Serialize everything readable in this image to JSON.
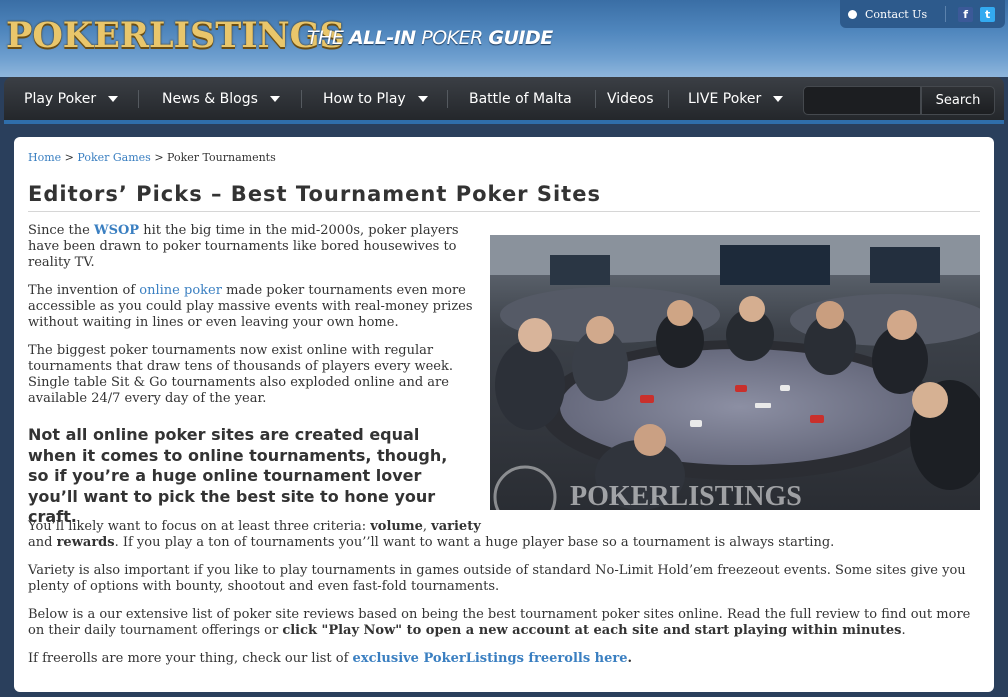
{
  "header": {
    "logo_text": "POKERLISTINGS",
    "tagline_prefix": "THE ",
    "tagline_bold": "ALL-IN",
    "tagline_mid": " POKER ",
    "tagline_end": "GUIDE",
    "contact_label": "Contact Us",
    "facebook_glyph": "f",
    "twitter_glyph": "t"
  },
  "nav": {
    "items": [
      {
        "label": "Play Poker",
        "has_dropdown": true
      },
      {
        "label": "News & Blogs",
        "has_dropdown": true
      },
      {
        "label": "How to Play",
        "has_dropdown": true
      },
      {
        "label": "Battle of Malta",
        "has_dropdown": false
      },
      {
        "label": "Videos",
        "has_dropdown": false
      },
      {
        "label": "LIVE Poker",
        "has_dropdown": true
      }
    ],
    "search_placeholder": "",
    "search_button": "Search"
  },
  "breadcrumb": {
    "home": "Home",
    "sep1": " > ",
    "games": "Poker Games",
    "sep2": " > ",
    "current": "Poker Tournaments"
  },
  "article": {
    "title": "Editors’ Picks – Best Tournament Poker Sites",
    "p1_a": "Since the ",
    "p1_link": "WSOP",
    "p1_b": " hit the big time in the mid-2000s, poker players have been drawn to poker tournaments like bored housewives to reality TV.",
    "p2_a": "The invention of ",
    "p2_link": "online poker",
    "p2_b": " made poker tournaments even more accessible as you could play massive events with real-money prizes without waiting in lines or even leaving your own home.",
    "p3": "The biggest poker tournaments now exist online with regular tournaments that draw tens of thousands of players every week. Single table Sit & Go tournaments also exploded online and are available 24/7 every day of the year.",
    "lead": "Not all online poker sites are created equal when it comes to online tournaments, though, so if you’re a huge online tournament lover you’ll want to pick the best site to hone your craft.",
    "p4_line1_a": "You’ll likely want to focus on at least three criteria: ",
    "p4_volume": "volume",
    "p4_comma": ", ",
    "p4_variety": "variety",
    "p4_and": "and ",
    "p4_rewards": "rewards",
    "p4_rest": ". If you play a ton of tournaments you’’ll want to want a huge player base so a tournament is always starting.",
    "p5": "Variety is also important if you like to play tournaments in games outside of standard No-Limit Hold’em freezeout events. Some sites give you plenty of options with bounty, shootout and even fast-fold tournaments.",
    "p6_a": "Below is a our extensive list of poker site reviews based on being the best tournament poker sites online. Read the full review to find out more on their daily tournament offerings or ",
    "p6_bold": "click \"Play Now\" to open a new account at each site and start playing within minutes",
    "p6_end": ".",
    "p7_a": "If freerolls are more your thing, check our list of ",
    "p7_link": "exclusive PokerListings freerolls here",
    "p7_end": ".",
    "photo_watermark": "POKERLISTINGS"
  }
}
